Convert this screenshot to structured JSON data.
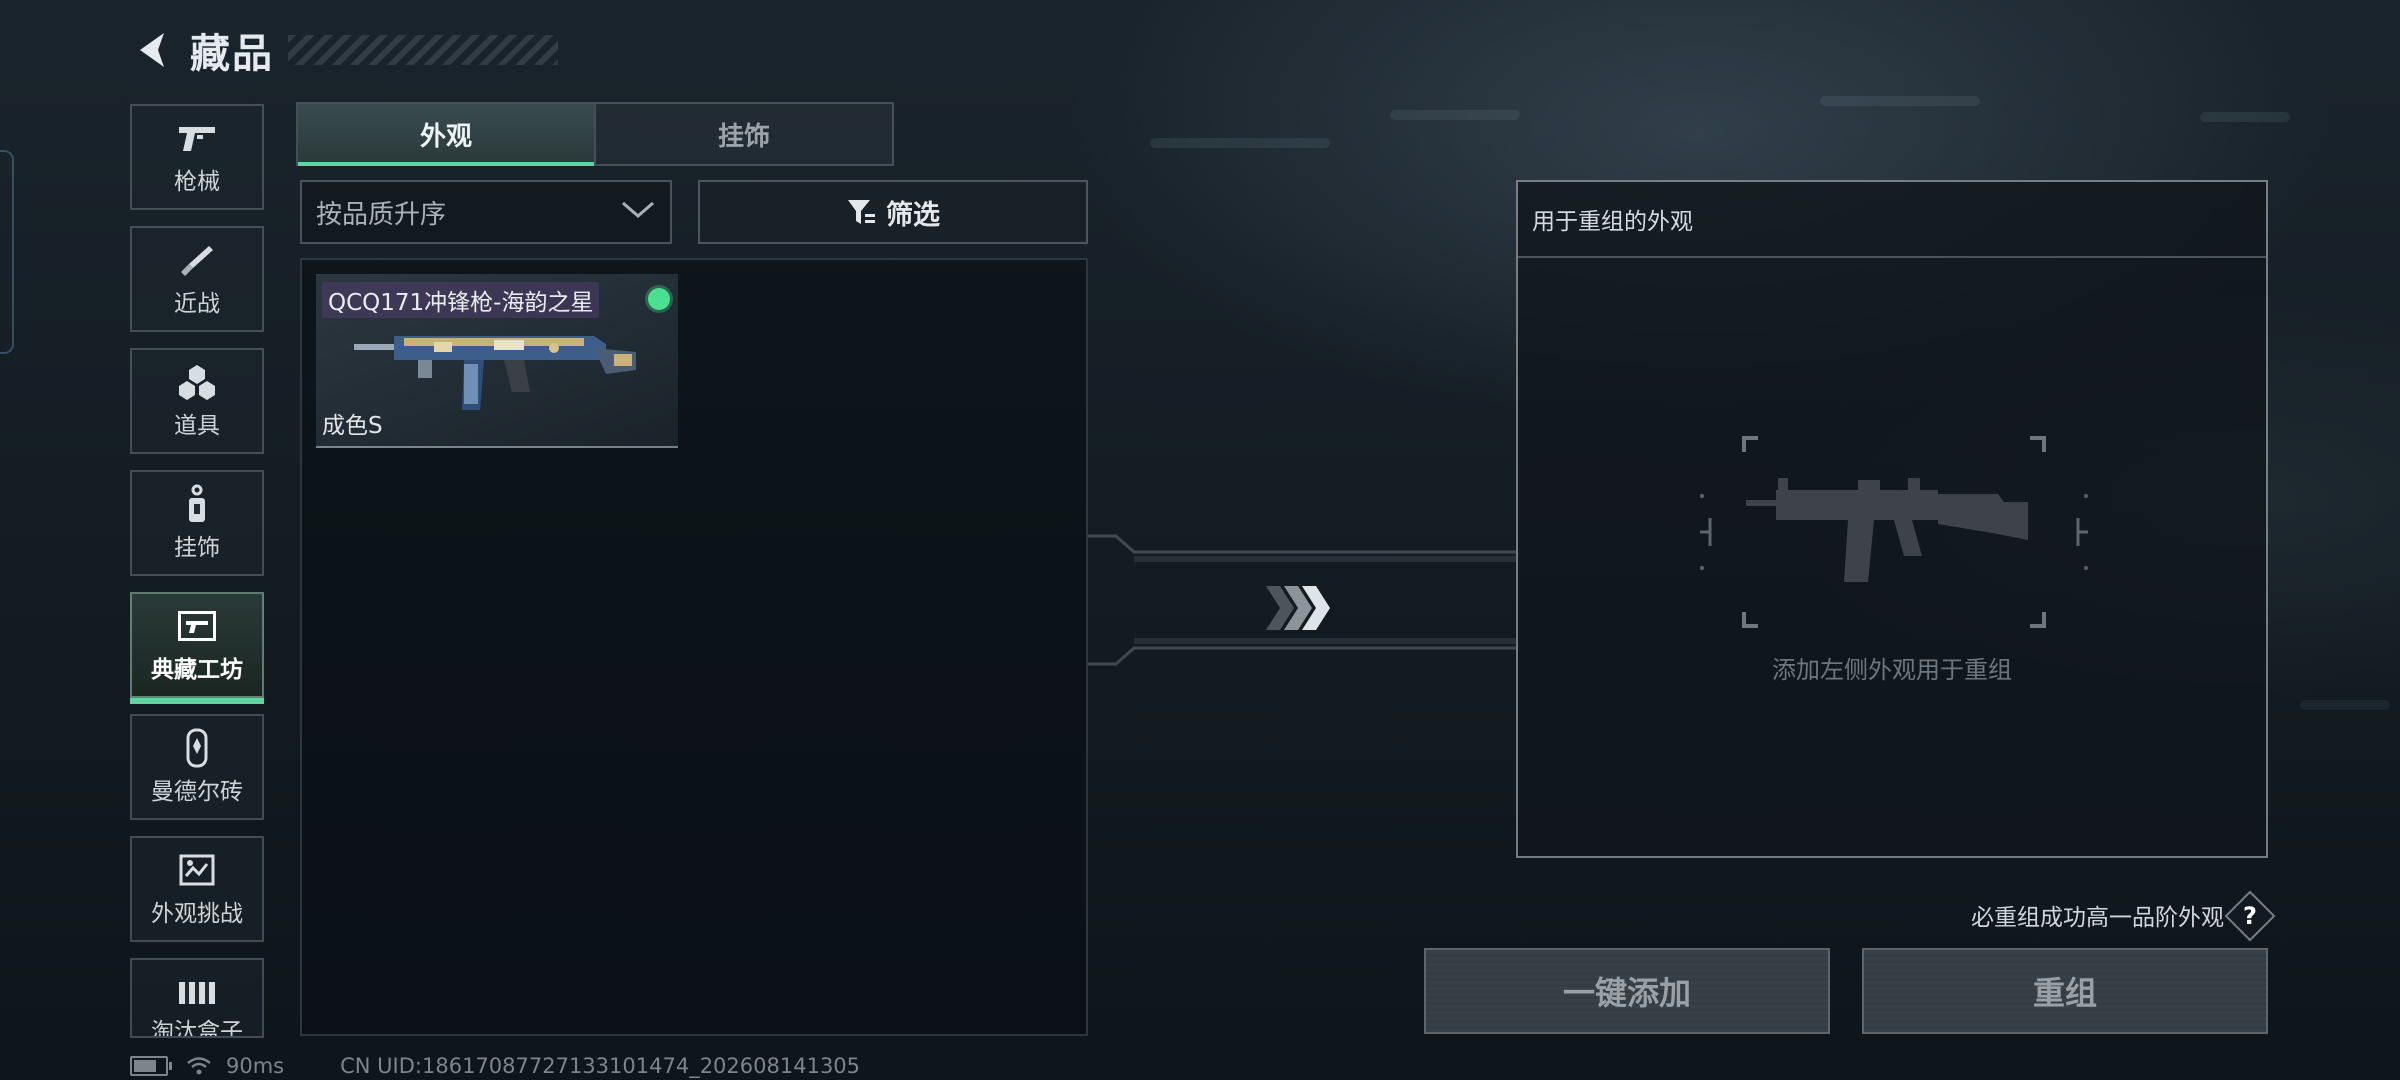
{
  "header": {
    "title": "藏品",
    "back_icon": "back-arrow-icon"
  },
  "sidebar": {
    "items": [
      {
        "label": "枪械",
        "icon": "pistol-icon",
        "active": false
      },
      {
        "label": "近战",
        "icon": "knife-icon",
        "active": false
      },
      {
        "label": "道具",
        "icon": "grenade-cluster-icon",
        "active": false
      },
      {
        "label": "挂饰",
        "icon": "charm-icon",
        "active": false
      },
      {
        "label": "典藏工坊",
        "icon": "workshop-icon",
        "active": true
      },
      {
        "label": "曼德尔砖",
        "icon": "mandel-brick-icon",
        "active": false
      },
      {
        "label": "外观挑战",
        "icon": "challenge-icon",
        "active": false
      },
      {
        "label": "淘汰盒子",
        "icon": "box-icon",
        "active": false
      }
    ]
  },
  "tabs": [
    {
      "label": "外观",
      "active": true
    },
    {
      "label": "挂饰",
      "active": false
    }
  ],
  "sort": {
    "value": "按品质升序"
  },
  "filter": {
    "label": "筛选"
  },
  "items": [
    {
      "name": "QCQ171冲锋枪-海韵之星",
      "grade": "成色S",
      "equipped": true
    }
  ],
  "combine_panel": {
    "title": "用于重组的外观",
    "hint": "添加左侧外观用于重组"
  },
  "note": "必重组成功高一品阶外观",
  "help_label": "?",
  "buttons": {
    "add_all": "一键添加",
    "combine": "重组"
  },
  "status": {
    "ping": "90ms",
    "uid": "CN UID:18617087727133101474_202608141305"
  },
  "colors": {
    "accent": "#5ed6a2",
    "equipped_dot": "#4be08f"
  }
}
